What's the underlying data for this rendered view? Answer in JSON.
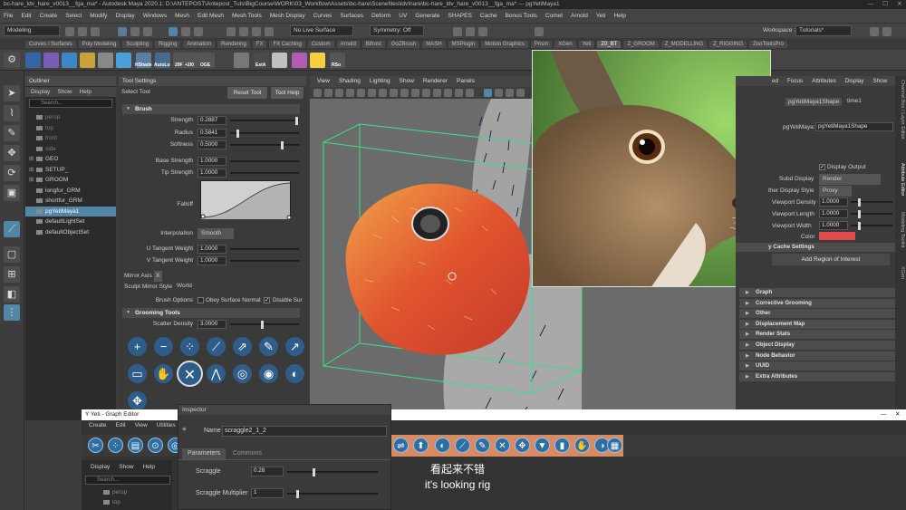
{
  "window": {
    "title": "bc-hare_ldv_hare_v0013__fga_ma* - Autodesk Maya 2020.1: D:\\ANTEPOST\\Antepost_Tuts\\BigCourse\\WORK\\03_Workflow\\Assets\\bc-hare\\Scenefiles\\ldv\\hare\\bc-hare_ldv_hare_v0013__fga_ma* --- pgYetiMaya1"
  },
  "menubar": [
    "File",
    "Edit",
    "Create",
    "Select",
    "Modify",
    "Display",
    "Windows",
    "Mesh",
    "Edit Mesh",
    "Mesh Tools",
    "Mesh Display",
    "Curves",
    "Surfaces",
    "Deform",
    "UV",
    "Generate",
    "SHAPES",
    "Cache",
    "Bonus Tools",
    "Comet",
    "Arnold",
    "Yeti",
    "Help"
  ],
  "status": {
    "mode": "Modeling",
    "live": "No Live Surface",
    "symmetry": "Symmetry: Off",
    "workspace_label": "Workspace :",
    "workspace": "Tutorials*"
  },
  "shelf_tabs": [
    "Curves / Surfaces",
    "Poly Modeling",
    "Sculpting",
    "Rigging",
    "Animation",
    "Rendering",
    "FX",
    "FX Caching",
    "Custom",
    "Arnold",
    "Bifrost",
    "GoZBrush",
    "MASH",
    "MSPlugin",
    "Motion Graphics",
    "Prism",
    "XGen",
    "Yeti",
    "Z0_BT",
    "Z_GROOM",
    "Z_MODELLING",
    "Z_RIGGING",
    "ZooToolsPro"
  ],
  "shelf_active": "Z0_BT",
  "shelf_labels": [
    "HShade",
    "AutoLo",
    "20F",
    "+2I0",
    "OGE",
    "EstA",
    "RSo"
  ],
  "outliner": {
    "title": "Outliner",
    "menu": [
      "Display",
      "Show",
      "Help"
    ],
    "search": "Search...",
    "items": [
      {
        "label": "persp",
        "dim": true
      },
      {
        "label": "top",
        "dim": true
      },
      {
        "label": "front",
        "dim": true
      },
      {
        "label": "side",
        "dim": true
      },
      {
        "label": "GEO",
        "dim": false
      },
      {
        "label": "SETUP_",
        "dim": false
      },
      {
        "label": "GROOM",
        "dim": false
      },
      {
        "label": "longfur_GRM",
        "dim": false
      },
      {
        "label": "shortfur_GRM",
        "dim": false
      },
      {
        "label": "pgYetiMaya1",
        "dim": false,
        "selected": true
      },
      {
        "label": "defaultLightSet",
        "dim": false
      },
      {
        "label": "defaultObjectSet",
        "dim": false
      }
    ]
  },
  "tool_settings": {
    "title": "Tool Settings",
    "subtitle": "Select Tool",
    "reset": "Reset Tool",
    "help": "Tool Help",
    "brush_header": "Brush",
    "strength_label": "Strength",
    "strength": "0.2887",
    "radius_label": "Radius",
    "radius": "0.5841",
    "softness_label": "Softness",
    "softness": "0.5000",
    "base_label": "Base Strength",
    "base": "1.0000",
    "tip_label": "Tip Strength",
    "tip": "1.0000",
    "falloff_label": "Falloff",
    "interp_label": "Interpolation",
    "interp": "Smooth",
    "u_label": "U Tangent Weight",
    "u": "1.0000",
    "v_label": "V Tangent Weight",
    "v": "1.0000",
    "mirror_label": "Mirror Axis",
    "mirror": "X",
    "sculpt_mirror_label": "Sculpt Mirror Style",
    "sculpt_mirror": "World",
    "brush_opts_label": "Brush Options",
    "obey": "Obey Surface Normal",
    "disable": "Disable Sur",
    "groom_header": "Grooming Tools",
    "density_label": "Scatter Density",
    "density": "3.0000"
  },
  "viewport_menu": [
    "View",
    "Shading",
    "Lighting",
    "Show",
    "Renderer",
    "Panels"
  ],
  "attr_editor": {
    "tabs_partial": [
      "ed",
      "Focus",
      "Attributes",
      "Display",
      "Show"
    ],
    "node_tab": "pgYetiMaya1Shape",
    "time_tab": "time1",
    "node_label": "pgYetiMaya:",
    "node_value": "pgYetiMaya1Shape",
    "display_output": "Display Output",
    "subd_label": "Subd Display",
    "subd": "Render",
    "other_label": "ther Display Style",
    "other": "Proxy",
    "vd_label": "Viewport Density",
    "vd": "1.0000",
    "vl_label": "Viewport Length",
    "vl": "1.0000",
    "vw_label": "Viewport Width",
    "vw": "1.0000",
    "color_label": "Color",
    "cache_label": "y Cache Settings",
    "add_region": "Add Region of Interest",
    "sections": [
      "Graph",
      "Corrective Grooming",
      "Other",
      "Displacement Map",
      "Render Stats",
      "Object Display",
      "Node Behavior",
      "UUID",
      "Extra Attributes"
    ]
  },
  "side_tabs": [
    "Channel Box / Layer Editor",
    "Attribute Editor",
    "Modeling Toolkit",
    "XGen"
  ],
  "graph_editor": {
    "title": "Yeti - Graph Editor",
    "menu": [
      "Create",
      "Edit",
      "View",
      "Utilities"
    ],
    "menu2": [
      "Display",
      "Show",
      "Help"
    ],
    "search": "Search...",
    "items": [
      "persp",
      "top"
    ]
  },
  "inspector": {
    "title": "Inspector",
    "name_label": "Name",
    "name": "scraggle2_1_2",
    "tabs": [
      "Parameters",
      "Commons"
    ],
    "scraggle_label": "Scraggle",
    "scraggle": "0.28",
    "mult_label": "Scraggle Multiplier",
    "mult": "1"
  },
  "subtitle": {
    "zh": "看起来不错",
    "en": "it's looking rig"
  },
  "colors": {
    "accent": "#5285a6",
    "groom_icon": "#2e5d8a",
    "yeti_icon": "#2d6fa5",
    "color_swatch": "#e04a4a"
  }
}
